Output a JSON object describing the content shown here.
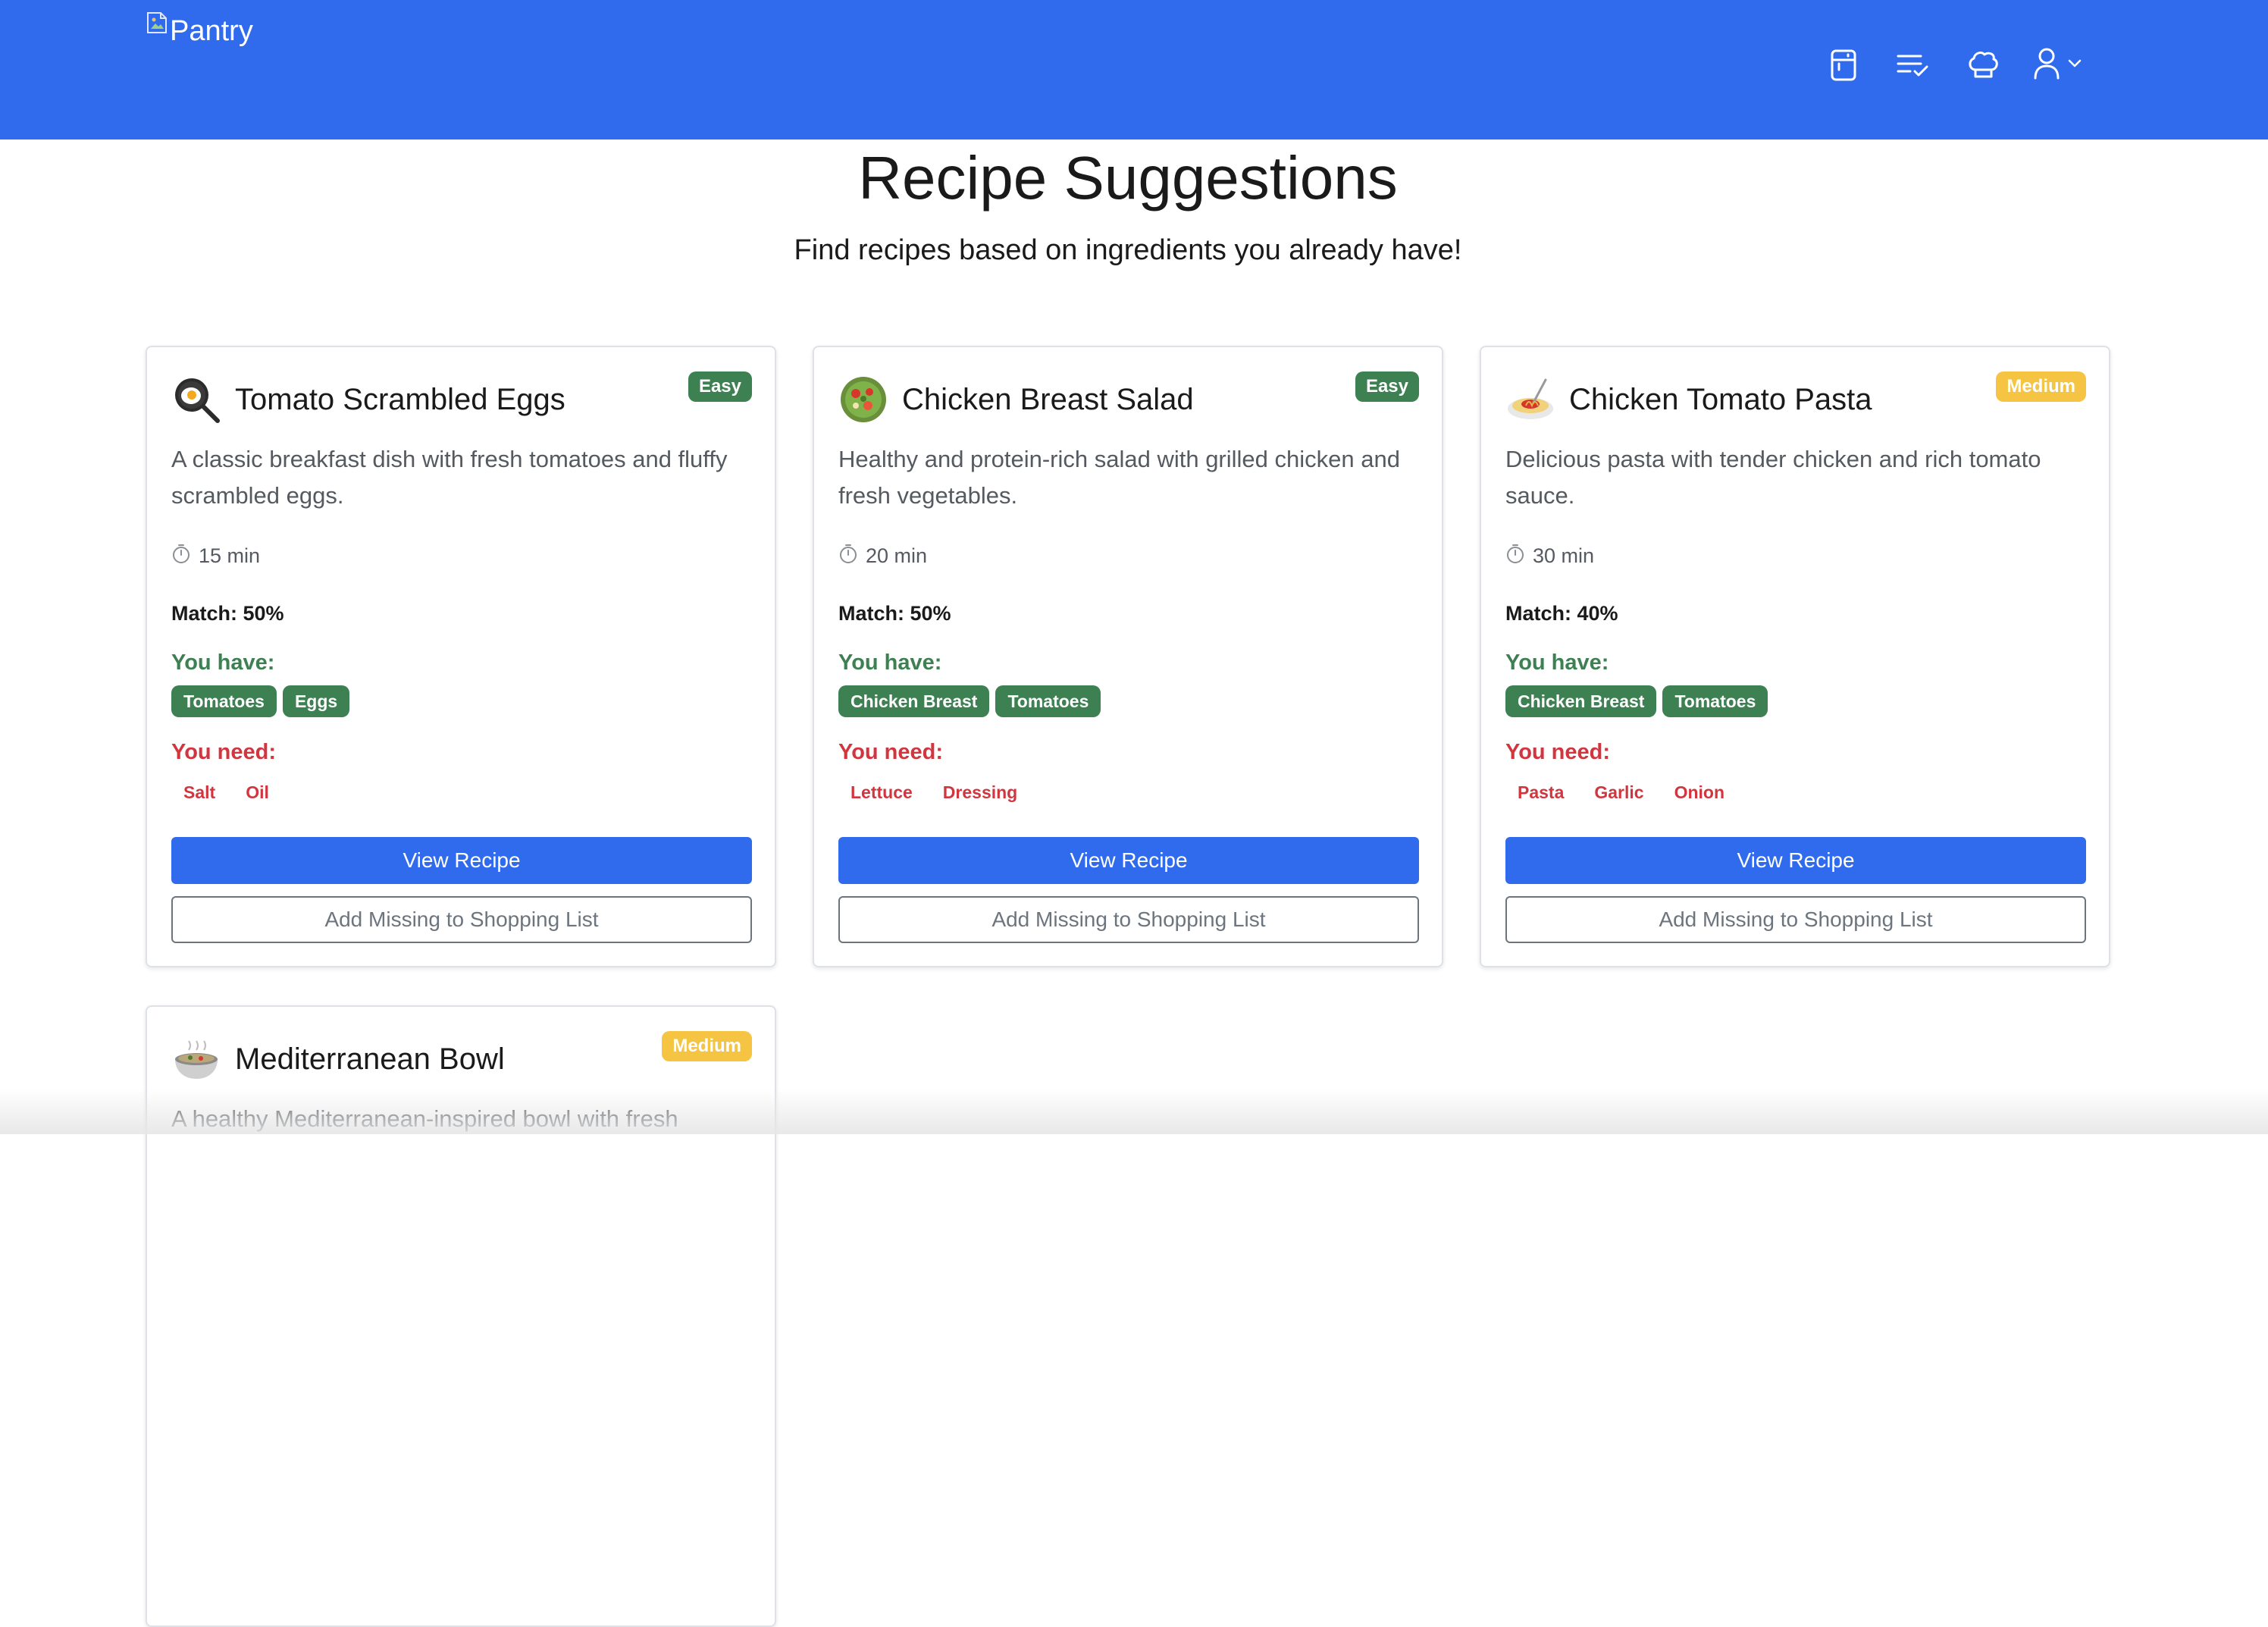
{
  "navbar": {
    "brand_alt": "Pantry",
    "icons": [
      "fridge-icon",
      "checklist-icon",
      "chef-hat-icon",
      "user-icon"
    ],
    "color": "#316bed"
  },
  "header": {
    "title": "Recipe Suggestions",
    "subtitle": "Find recipes based on ingredients you already have!"
  },
  "labels": {
    "you_have": "You have:",
    "you_need": "You need:",
    "view_recipe": "View Recipe",
    "add_missing": "Add Missing to Shopping List"
  },
  "recipes": [
    {
      "emoji": "🍳",
      "title": "Tomato Scrambled Eggs",
      "difficulty": "Easy",
      "description": "A classic breakfast dish with fresh tomatoes and fluffy scrambled eggs.",
      "time": "15 min",
      "match": "Match: 50%",
      "have": [
        "Tomatoes",
        "Eggs"
      ],
      "need": [
        "Salt",
        "Oil"
      ]
    },
    {
      "emoji": "🥗",
      "title": "Chicken Breast Salad",
      "difficulty": "Easy",
      "description": "Healthy and protein-rich salad with grilled chicken and fresh vegetables.",
      "time": "20 min",
      "match": "Match: 50%",
      "have": [
        "Chicken Breast",
        "Tomatoes"
      ],
      "need": [
        "Lettuce",
        "Dressing"
      ]
    },
    {
      "emoji": "🍝",
      "title": "Chicken Tomato Pasta",
      "difficulty": "Medium",
      "description": "Delicious pasta with tender chicken and rich tomato sauce.",
      "time": "30 min",
      "match": "Match: 40%",
      "have": [
        "Chicken Breast",
        "Tomatoes"
      ],
      "need": [
        "Pasta",
        "Garlic",
        "Onion"
      ]
    },
    {
      "emoji": "🍲",
      "title": "Mediterranean Bowl",
      "difficulty": "Medium",
      "description": "A healthy Mediterranean-inspired bowl with fresh"
    }
  ],
  "colors": {
    "have": "#3d8052",
    "need": "#d1363f",
    "easy": "#3d8052",
    "medium": "#f5c443",
    "primary": "#316bed"
  }
}
